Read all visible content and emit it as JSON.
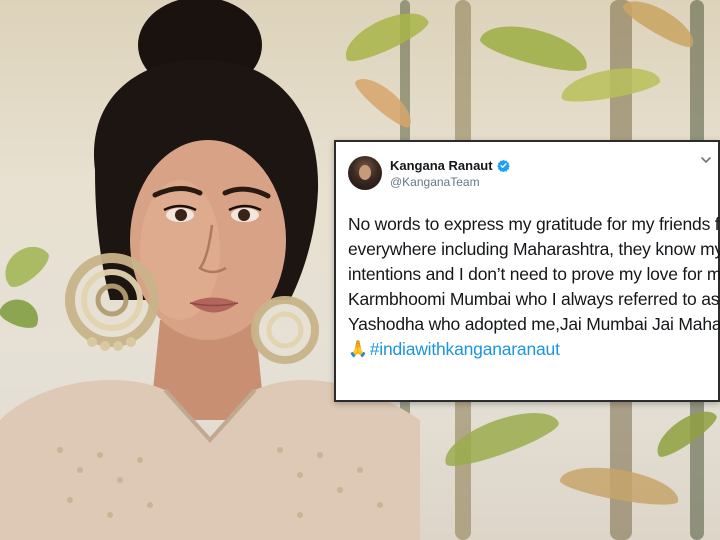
{
  "tweet": {
    "author_name": "Kangana Ranaut",
    "author_handle": "@KanganaTeam",
    "verified": true,
    "lines": [
      "No words to express my gratitude for  my friends from",
      "everywhere including Maharashtra, they know my",
      "intentions and I don’t need to prove my love for my",
      "Karmbhoomi Mumbai who I always referred to as Maa",
      "Yashodha who adopted me,Jai Mumbai Jai Maharashtra"
    ],
    "emoji": "🙏",
    "hashtag": "#indiawithkanganaranaut"
  },
  "colors": {
    "link": "#1b95e0",
    "verified": "#1da1f2",
    "card_border": "#2c2c2c",
    "text": "#14171a",
    "handle": "#657786"
  },
  "icons": {
    "verified": "verified-badge-icon",
    "menu": "chevron-down-icon",
    "emoji": "folded-hands-icon"
  }
}
